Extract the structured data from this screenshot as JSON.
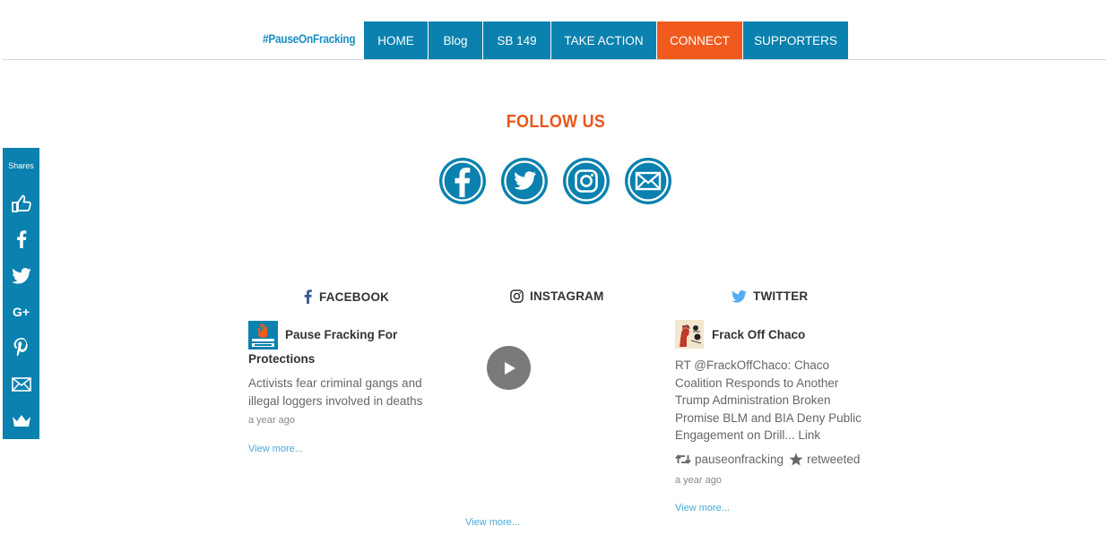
{
  "header": {
    "logo_text": "#PauseOnFracking",
    "nav": [
      {
        "label": "HOME"
      },
      {
        "label": "Blog"
      },
      {
        "label": "SB 149"
      },
      {
        "label": "TAKE ACTION"
      },
      {
        "label": "CONNECT",
        "active": true
      },
      {
        "label": "SUPPORTERS"
      }
    ]
  },
  "follow": {
    "title": "FOLLOW US",
    "icons": [
      "facebook-icon",
      "twitter-icon",
      "instagram-icon",
      "email-icon"
    ]
  },
  "sharebar": {
    "label": "Shares",
    "icons": [
      "thumbs-up-icon",
      "facebook-icon",
      "twitter-icon",
      "google-plus-icon",
      "pinterest-icon",
      "email-icon",
      "crown-icon"
    ],
    "gplus_text": "G+"
  },
  "columns": {
    "facebook": {
      "heading": "FACEBOOK",
      "author": "Pause Fracking For Protections",
      "text": "Activists fear criminal gangs and illegal loggers involved in deaths",
      "time": "a year ago",
      "view_more": "View more..."
    },
    "instagram": {
      "heading": "INSTAGRAM",
      "view_more": "View more..."
    },
    "twitter": {
      "heading": "TWITTER",
      "author": "Frack Off Chaco",
      "text": "RT @FrackOffChaco: Chaco Coalition Responds to Another Trump Administration Broken Promise BLM and BIA Deny Public Engagement on Drill... Link",
      "retweet_user": "pauseonfracking",
      "retweet_label": "retweeted",
      "time": "a year ago",
      "view_more": "View more..."
    }
  },
  "colors": {
    "brand_blue": "#0a81ae",
    "accent_orange": "#f15a1d",
    "link_blue": "#4aa9d6"
  }
}
